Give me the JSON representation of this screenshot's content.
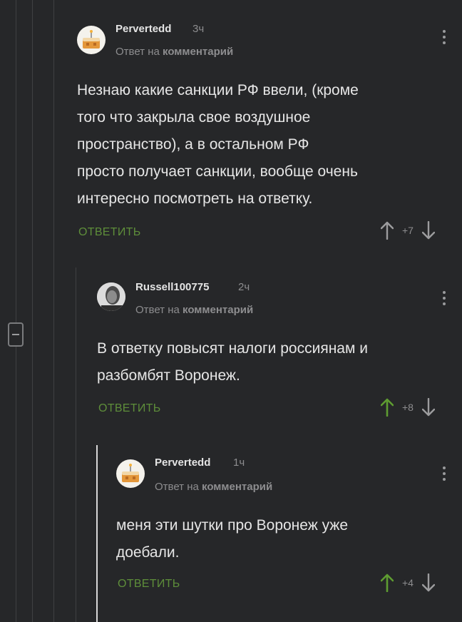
{
  "comments": [
    {
      "author": "Pervertedd",
      "time": "3ч",
      "reply_prefix": "Ответ на",
      "reply_target": "комментарий",
      "lines": [
        "Незнаю какие санкции РФ ввели, (кроме",
        "того что закрыла свое воздушное",
        "пространство), а в остальном РФ",
        "просто получает санкции, вообще очень",
        "интересно посмотреть на ответку."
      ],
      "reply_label": "ОТВЕТИТЬ",
      "score": "+7",
      "upvoted": false
    },
    {
      "author": "Russell100775",
      "time": "2ч",
      "reply_prefix": "Ответ на",
      "reply_target": "комментарий",
      "lines": [
        "В ответку повысят налоги россиянам и",
        "разбомбят Воронеж."
      ],
      "reply_label": "ОТВЕТИТЬ",
      "score": "+8",
      "upvoted": true
    },
    {
      "author": "Pervertedd",
      "time": "1ч",
      "reply_prefix": "Ответ на",
      "reply_target": "комментарий",
      "lines": [
        "меня эти шутки про Воронеж уже",
        "доебали."
      ],
      "reply_label": "ОТВЕТИТЬ",
      "score": "+4",
      "upvoted": true
    }
  ],
  "colors": {
    "background": "#262729",
    "reply_green": "#5e8e3a",
    "upvote_active": "#5e9c31",
    "thread_line": "#3f4042"
  },
  "icons": [
    "avatar-cake-icon",
    "avatar-person-icon",
    "menu-dots-icon",
    "upvote-arrow-icon",
    "downvote-arrow-icon",
    "collapse-thread-icon"
  ]
}
